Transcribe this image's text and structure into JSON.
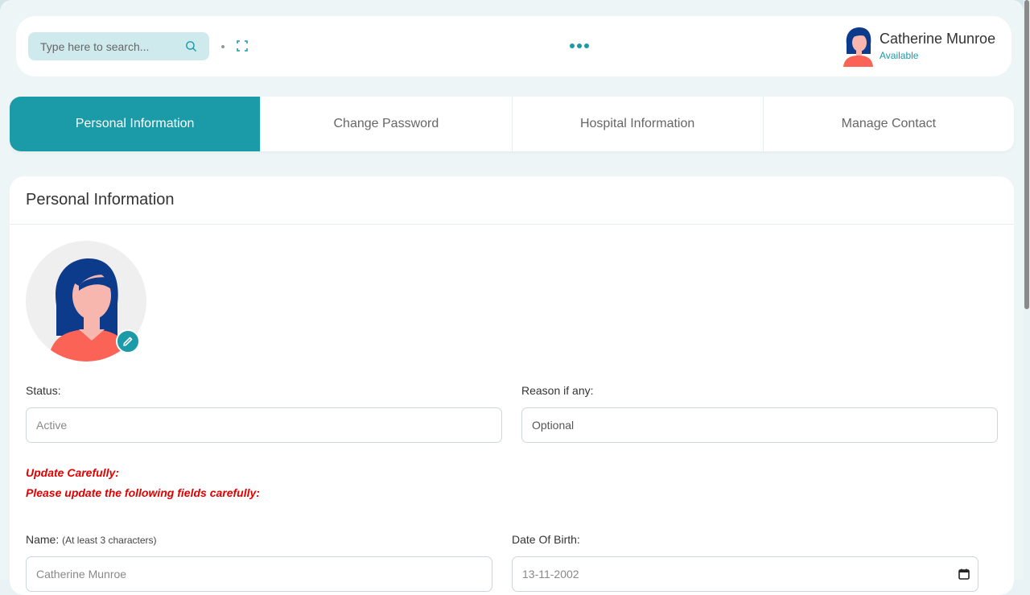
{
  "search": {
    "placeholder": "Type here to search..."
  },
  "user": {
    "name": "Catherine Munroe",
    "status": "Available"
  },
  "tabs": [
    {
      "label": "Personal Information",
      "active": true
    },
    {
      "label": "Change Password",
      "active": false
    },
    {
      "label": "Hospital Information",
      "active": false
    },
    {
      "label": "Manage Contact",
      "active": false
    }
  ],
  "card": {
    "title": "Personal Information"
  },
  "form": {
    "status_label": "Status:",
    "status_value": "Active",
    "reason_label": "Reason if any:",
    "reason_value": "Optional",
    "warn_title": "Update Carefully:",
    "warn_text": "Please update the following fields carefully:",
    "name_label": "Name:",
    "name_hint": "(At least 3 characters)",
    "name_value": "Catherine Munroe",
    "dob_label": "Date Of Birth:",
    "dob_value": "13-11-2002"
  },
  "colors": {
    "accent": "#1b9aa8",
    "warning": "#e00000"
  },
  "icons": [
    "search-icon",
    "expand-icon",
    "more-icon",
    "edit-icon",
    "calendar-icon"
  ]
}
